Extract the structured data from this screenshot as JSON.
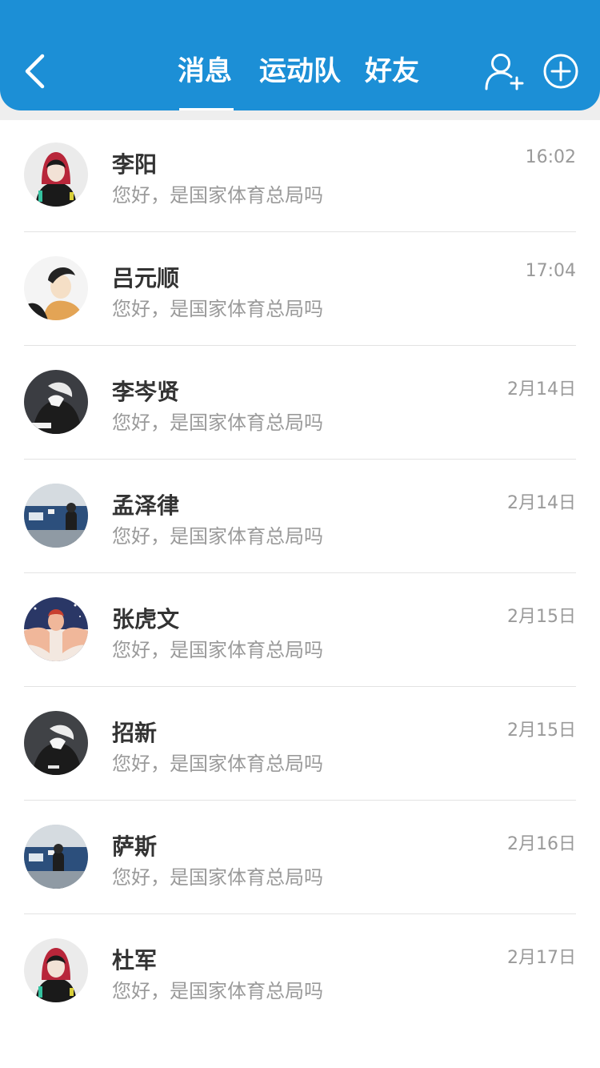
{
  "header": {
    "tabs": [
      {
        "label": "消息",
        "active": true
      },
      {
        "label": "运动队",
        "active": false
      },
      {
        "label": "好友",
        "active": false
      }
    ],
    "icons": {
      "back": "chevron-left-icon",
      "add_user": "add-user-icon",
      "add": "plus-circle-icon"
    },
    "color": "#1c8fd6"
  },
  "messages": [
    {
      "name": "李阳",
      "preview": "您好，是国家体育总局吗",
      "time": "16:02"
    },
    {
      "name": "吕元顺",
      "preview": "您好，是国家体育总局吗",
      "time": "17:04"
    },
    {
      "name": "李岑贤",
      "preview": "您好，是国家体育总局吗",
      "time": "2月14日"
    },
    {
      "name": "孟泽律",
      "preview": "您好，是国家体育总局吗",
      "time": "2月14日"
    },
    {
      "name": "张虎文",
      "preview": "您好，是国家体育总局吗",
      "time": "2月15日"
    },
    {
      "name": "招新",
      "preview": "您好，是国家体育总局吗",
      "time": "2月15日"
    },
    {
      "name": "萨斯",
      "preview": "您好，是国家体育总局吗",
      "time": "2月16日"
    },
    {
      "name": "杜军",
      "preview": "您好，是国家体育总局吗",
      "time": "2月17日"
    }
  ]
}
